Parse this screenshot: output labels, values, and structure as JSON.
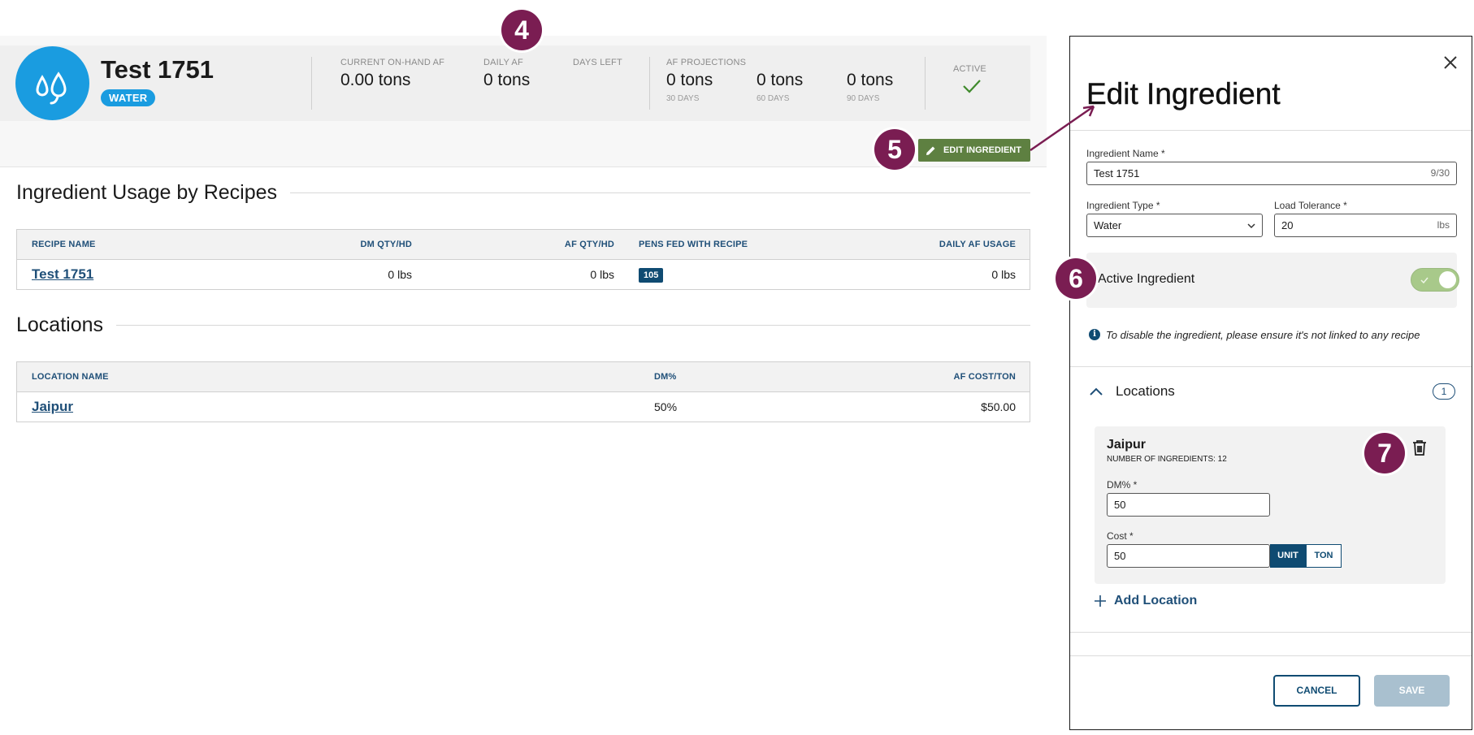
{
  "ingredient": {
    "title": "Test 1751",
    "type_badge": "WATER"
  },
  "stats": {
    "current_on_hand_label": "CURRENT ON-HAND AF",
    "current_on_hand_value": "0.00 tons",
    "daily_af_label": "DAILY AF",
    "daily_af_value": "0 tons",
    "days_left_label": "DAYS LEFT",
    "projections_label": "AF PROJECTIONS",
    "projections": [
      {
        "value": "0 tons",
        "period": "30 DAYS"
      },
      {
        "value": "0 tons",
        "period": "60 DAYS"
      },
      {
        "value": "0 tons",
        "period": "90 DAYS"
      }
    ],
    "active_label": "ACTIVE"
  },
  "edit_button_label": "EDIT INGREDIENT",
  "markers": [
    "4",
    "5",
    "6",
    "7"
  ],
  "usage": {
    "title": "Ingredient Usage by Recipes",
    "headers": [
      "RECIPE NAME",
      "DM QTY/HD",
      "AF QTY/HD",
      "PENS FED WITH RECIPE",
      "DAILY AF USAGE"
    ],
    "rows": [
      {
        "recipe": "Test 1751",
        "dm_qty": "0 lbs",
        "af_qty": "0 lbs",
        "pens": "105",
        "daily_af": "0 lbs"
      }
    ]
  },
  "locations_section": {
    "title": "Locations",
    "headers": [
      "LOCATION NAME",
      "DM%",
      "AF COST/TON"
    ],
    "rows": [
      {
        "name": "Jaipur",
        "dm": "50%",
        "cost": "$50.00"
      }
    ]
  },
  "drawer": {
    "title": "Edit Ingredient",
    "name_label": "Ingredient Name *",
    "name_value": "Test 1751",
    "name_count": "9/30",
    "type_label": "Ingredient Type *",
    "type_value": "Water",
    "tolerance_label": "Load Tolerance *",
    "tolerance_value": "20",
    "tolerance_unit": "lbs",
    "active_label": "Active Ingredient",
    "active_on": true,
    "info_text": "To disable the ingredient, please ensure it's not linked to any recipe",
    "locations_title": "Locations",
    "locations_count": "1",
    "location": {
      "name": "Jaipur",
      "sub": "NUMBER OF INGREDIENTS: 12",
      "dm_label": "DM% *",
      "dm_value": "50",
      "cost_label": "Cost *",
      "cost_value": "50",
      "unit_options": [
        "UNIT",
        "TON"
      ],
      "unit_selected": "UNIT"
    },
    "add_location_label": "Add Location",
    "cancel_label": "CANCEL",
    "save_label": "SAVE"
  },
  "colors": {
    "brand_blue": "#1a9ce0",
    "navy": "#0f4b72",
    "edit_green": "#5e8041",
    "marker": "#7a1d52",
    "toggle_on": "#a8c98a",
    "save_disabled": "#a9c0cf"
  }
}
